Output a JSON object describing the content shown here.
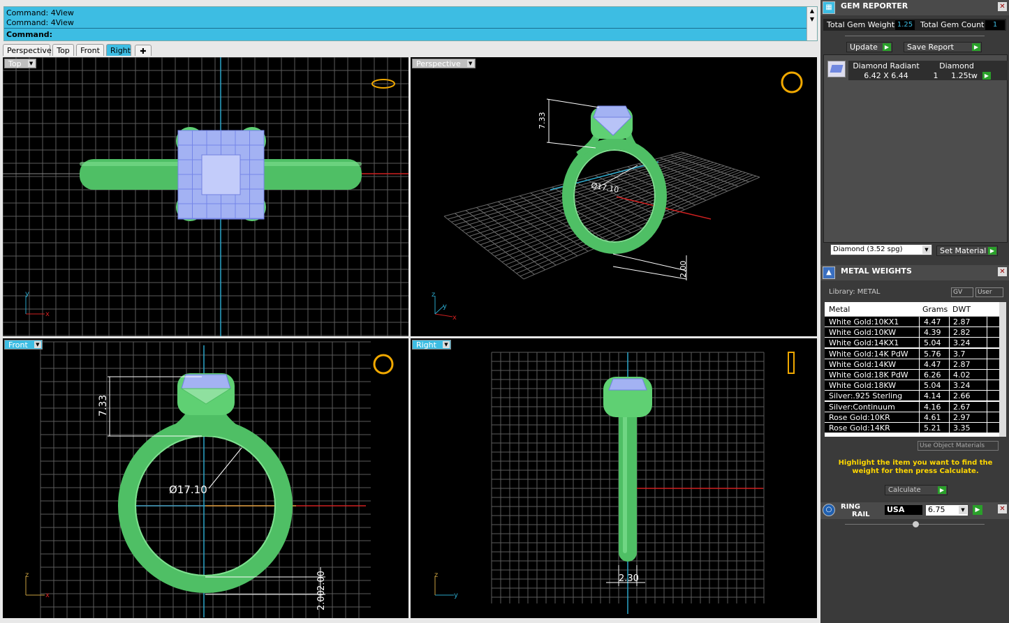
{
  "command": {
    "history": [
      "Command: 4View",
      "Command: 4View"
    ],
    "prompt": "Command:",
    "scroll_up": "▲",
    "scroll_down": "▼"
  },
  "tabs": [
    {
      "label": "Perspective",
      "active": false
    },
    {
      "label": "Top",
      "active": false
    },
    {
      "label": "Front",
      "active": false
    },
    {
      "label": "Right",
      "active": true
    },
    {
      "label": "✚",
      "active": false
    }
  ],
  "viewports": {
    "top": {
      "label": "Top",
      "axis_y": "y",
      "axis_x": "x"
    },
    "perspective": {
      "label": "Perspective",
      "dim_height": "7.33",
      "dim_diameter": "Ø17.10",
      "dim_width": "2.00",
      "axis_z": "z",
      "axis_y": "y",
      "axis_x": "x"
    },
    "front": {
      "label": "Front",
      "dim_height": "7.33",
      "dim_diameter": "Ø17.10",
      "dim_band": "2.00",
      "dim_band2": "2.00",
      "axis_z": "z",
      "axis_x": "x"
    },
    "right": {
      "label": "Right",
      "dim_width": "2.30",
      "axis_z": "z",
      "axis_y": "y"
    }
  },
  "gem_reporter": {
    "title": "GEM REPORTER",
    "total_weight_label": "Total Gem Weight",
    "total_weight_value": "1.25",
    "total_count_label": "Total Gem Count",
    "total_count_value": "1",
    "update_label": "Update",
    "save_report_label": "Save Report",
    "gem": {
      "name": "Diamond Radiant",
      "size": "6.42 X 6.44",
      "material": "Diamond",
      "count": "1",
      "weight": "1.25tw"
    },
    "material_select": "Diamond    (3.52 spg)",
    "set_material_label": "Set Material"
  },
  "metal_weights": {
    "title": "METAL WEIGHTS",
    "library_label": "Library: METAL",
    "gv_label": "GV",
    "user_label": "User",
    "columns": [
      "Metal",
      "Grams",
      "DWT"
    ],
    "rows": [
      [
        "White Gold:10KX1",
        "4.47",
        "2.87"
      ],
      [
        "White Gold:10KW",
        "4.39",
        "2.82"
      ],
      [
        "White Gold:14KX1",
        "5.04",
        "3.24"
      ],
      [
        "White Gold:14K PdW",
        "5.76",
        "3.7"
      ],
      [
        "White Gold:14KW",
        "4.47",
        "2.87"
      ],
      [
        "White Gold:18K PdW",
        "6.26",
        "4.02"
      ],
      [
        "White Gold:18KW",
        "5.04",
        "3.24"
      ],
      [
        "Silver:.925 Sterling",
        "4.14",
        "2.66"
      ],
      [
        "Silver:Continuum",
        "4.16",
        "2.67"
      ],
      [
        "Rose Gold:10KR",
        "4.61",
        "2.97"
      ],
      [
        "Rose Gold:14KR",
        "5.21",
        "3.35"
      ]
    ],
    "use_object_materials": "Use Object Materials",
    "hint": "Highlight the item you want to find the weight for then press Calculate.",
    "calculate_label": "Calculate"
  },
  "ring_rail": {
    "title_1": "RING",
    "title_2": "RAIL",
    "region": "USA",
    "size": "6.75"
  },
  "colors": {
    "accent": "#3dbde3",
    "ring": "#5fd073",
    "gem": "#9aaaf0",
    "dim": "#ffffff",
    "hint": "#ffd700"
  }
}
